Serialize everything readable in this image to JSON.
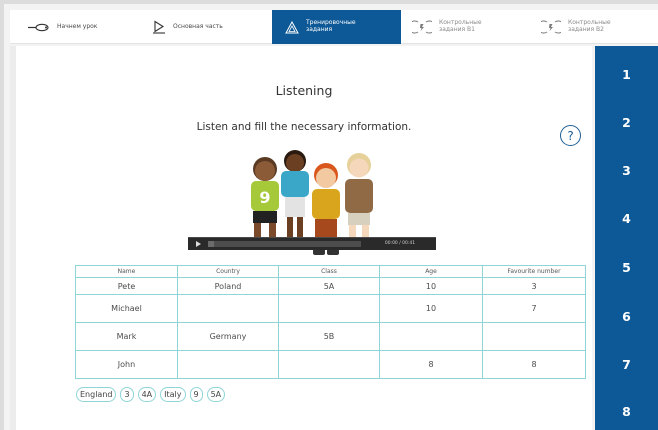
{
  "nav": {
    "items": [
      {
        "label": "Начнем урок",
        "icon": "rocket-icon"
      },
      {
        "label": "Основная часть",
        "icon": "play-screen-icon"
      },
      {
        "label": "Тренировочные\nзадания",
        "icon": "triangle-warning-icon"
      },
      {
        "label": "Контрольные\nзадания B1",
        "icon": "lightbulb-gear-icon"
      },
      {
        "label": "Контрольные\nзадания B2",
        "icon": "lightbulb-gear-icon"
      }
    ],
    "active_index": 2
  },
  "page": {
    "title": "Listening",
    "instruction": "Listen and fill the necessary information.",
    "help_symbol": "?"
  },
  "player": {
    "time": "00:00 / 00:41",
    "progress": 0.04
  },
  "table": {
    "headers": [
      "Name",
      "Country",
      "Class",
      "Age",
      "Favourite number"
    ],
    "rows": [
      [
        "Pete",
        "Poland",
        "5A",
        "10",
        "3"
      ],
      [
        "Michael",
        "",
        "",
        "10",
        "7"
      ],
      [
        "Mark",
        "Germany",
        "5B",
        "",
        ""
      ],
      [
        "John",
        "",
        "",
        "8",
        "8"
      ]
    ]
  },
  "chips": [
    "England",
    "3",
    "4A",
    "Italy",
    "9",
    "5A"
  ],
  "rail": {
    "items": [
      "1",
      "2",
      "3",
      "4",
      "5",
      "6",
      "7",
      "8"
    ]
  },
  "colors": {
    "accent": "#0d5896",
    "table_border": "#8fd5d8",
    "background": "#ffffff"
  }
}
